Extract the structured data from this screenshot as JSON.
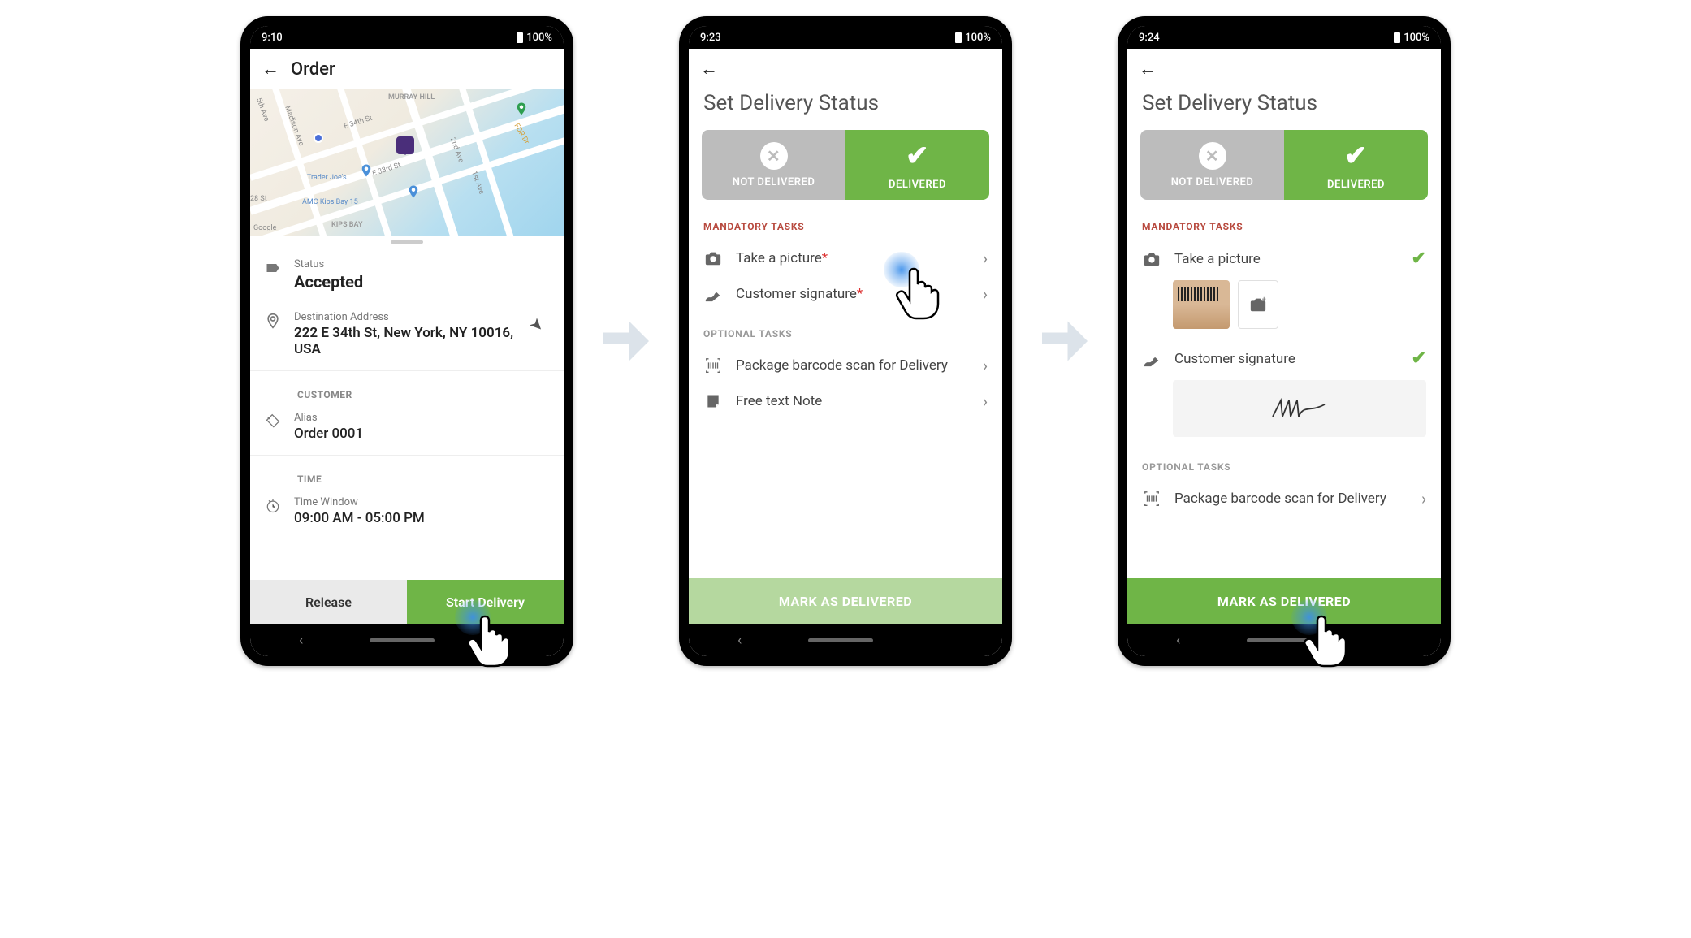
{
  "screen1": {
    "statusbar": {
      "time": "9:10",
      "battery": "100%"
    },
    "header": {
      "title": "Order"
    },
    "map": {
      "labels": [
        "MURRAY HILL",
        "KIPS BAY",
        "E 34th St",
        "E 33rd St",
        "Madison Ave",
        "5th Ave",
        "2nd Ave",
        "1st Ave",
        "FDR Dr",
        "28 St",
        "Trader Joe's",
        "AMC Kips Bay 15"
      ],
      "attribution": "Google"
    },
    "status": {
      "label": "Status",
      "value": "Accepted"
    },
    "destination": {
      "label": "Destination Address",
      "value": "222 E 34th St, New York, NY 10016, USA"
    },
    "customer_section": "CUSTOMER",
    "alias": {
      "label": "Alias",
      "value": "Order 0001"
    },
    "time_section": "TIME",
    "timewindow": {
      "label": "Time Window",
      "value": "09:00 AM - 05:00 PM"
    },
    "buttons": {
      "release": "Release",
      "start": "Start Delivery"
    }
  },
  "screen2": {
    "statusbar": {
      "time": "9:23",
      "battery": "100%"
    },
    "title": "Set Delivery Status",
    "toggle": {
      "not": "NOT DELIVERED",
      "yes": "DELIVERED"
    },
    "mandatory_label": "MANDATORY TASKS",
    "tasks_mandatory": [
      {
        "label": "Take a picture",
        "required": true
      },
      {
        "label": "Customer signature",
        "required": true
      }
    ],
    "optional_label": "OPTIONAL TASKS",
    "tasks_optional": [
      {
        "label": "Package barcode scan for Delivery"
      },
      {
        "label": "Free text Note"
      }
    ],
    "mark_button": "MARK AS DELIVERED"
  },
  "screen3": {
    "statusbar": {
      "time": "9:24",
      "battery": "100%"
    },
    "title": "Set Delivery Status",
    "toggle": {
      "not": "NOT DELIVERED",
      "yes": "DELIVERED"
    },
    "mandatory_label": "MANDATORY TASKS",
    "tasks_mandatory": [
      {
        "label": "Take a picture",
        "done": true
      },
      {
        "label": "Customer signature",
        "done": true
      }
    ],
    "optional_label": "OPTIONAL TASKS",
    "tasks_optional": [
      {
        "label": "Package barcode scan for Delivery"
      }
    ],
    "mark_button": "MARK AS DELIVERED"
  }
}
